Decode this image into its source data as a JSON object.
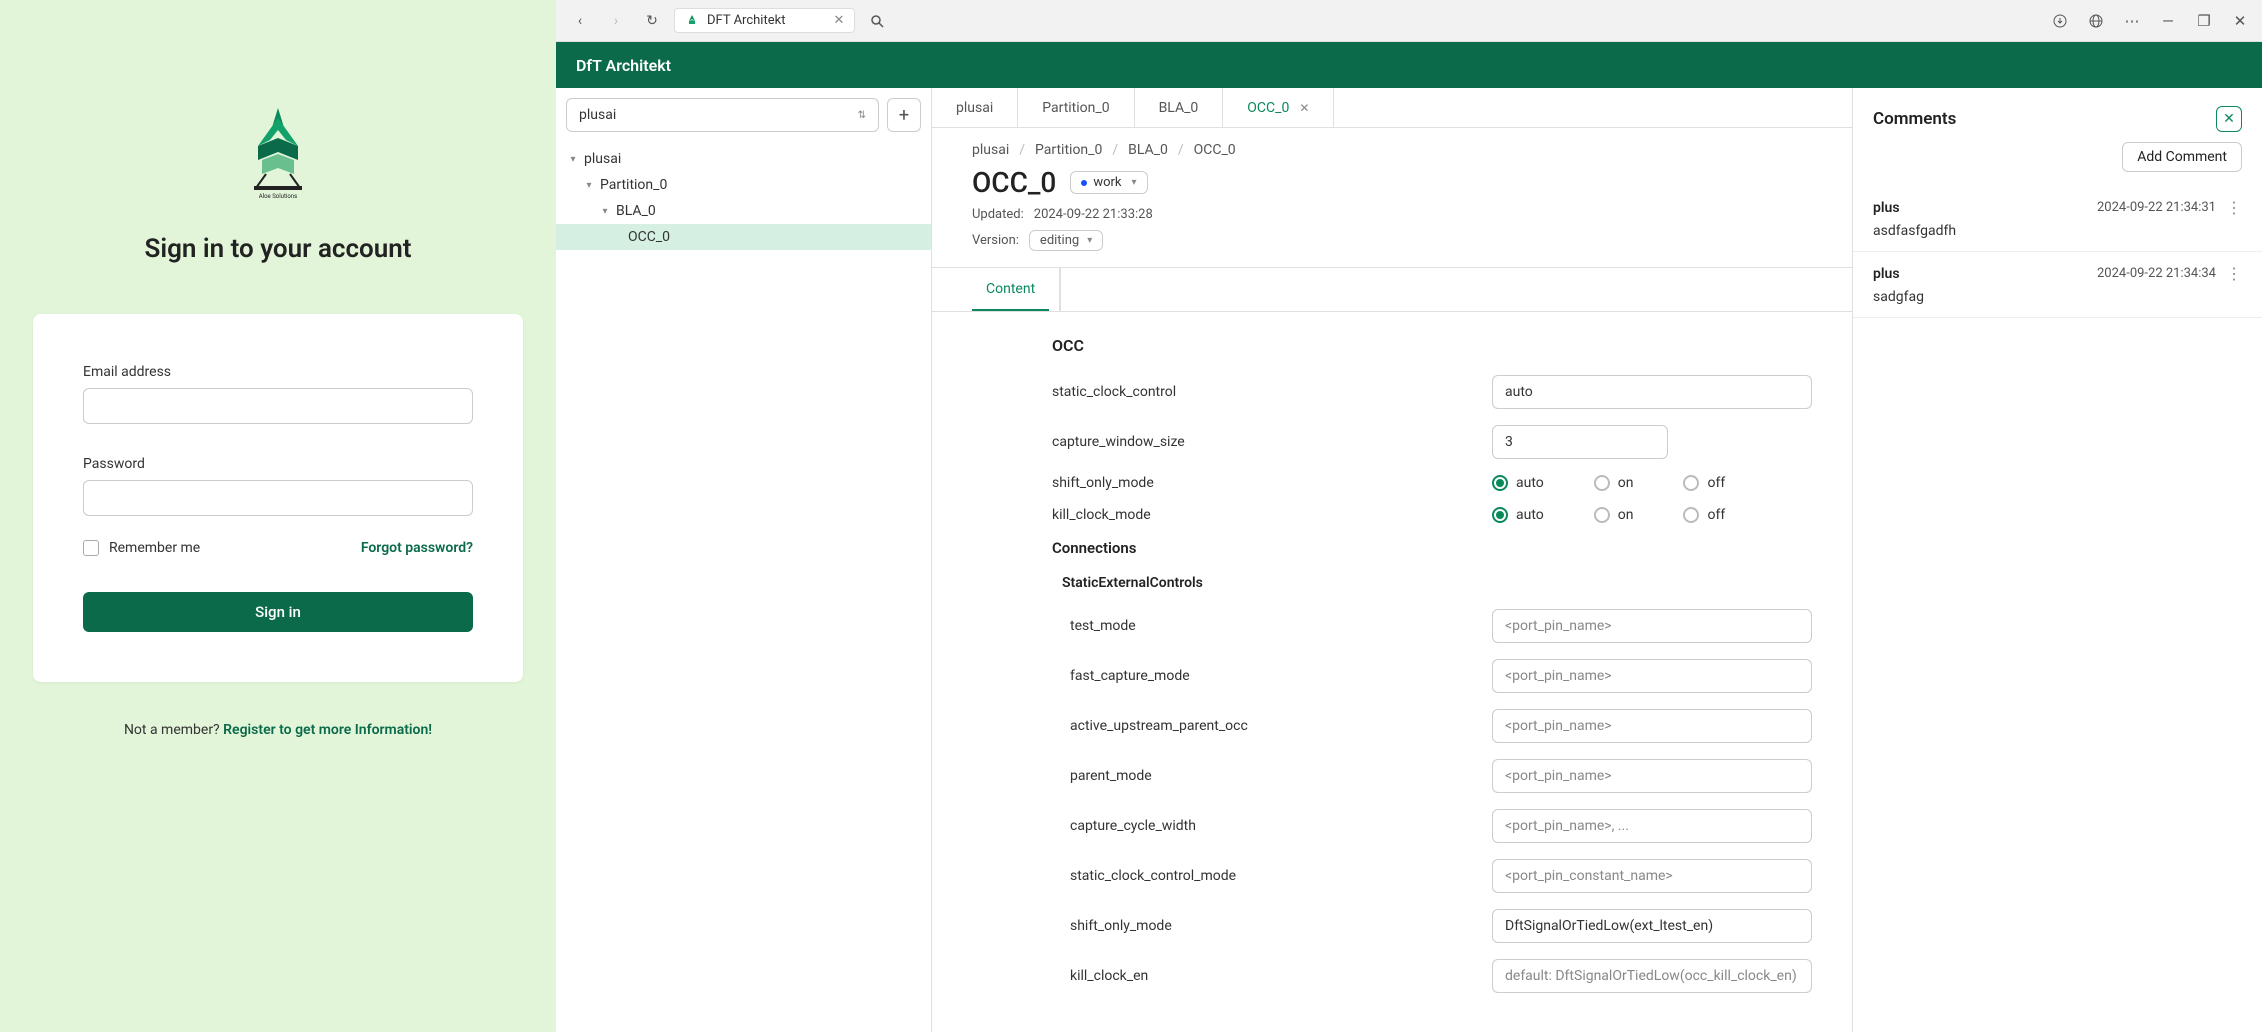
{
  "login": {
    "signin_title": "Sign in to your account",
    "email_label": "Email address",
    "password_label": "Password",
    "remember_label": "Remember me",
    "forgot_label": "Forgot password?",
    "signin_button": "Sign in",
    "register_prefix": "Not a member? ",
    "register_link": "Register to get more Information!",
    "logo_caption": "Aloe Solutions"
  },
  "chrome": {
    "tab_title": "DFT Architekt"
  },
  "header": {
    "title": "DfT Architekt"
  },
  "tree": {
    "selector_value": "plusai",
    "items": [
      "plusai",
      "Partition_0",
      "BLA_0",
      "OCC_0"
    ]
  },
  "tabs": [
    "plusai",
    "Partition_0",
    "BLA_0",
    "OCC_0"
  ],
  "breadcrumb": [
    "plusai",
    "Partition_0",
    "BLA_0",
    "OCC_0"
  ],
  "page": {
    "title": "OCC_0",
    "tag": "work",
    "updated_label": "Updated:",
    "updated_value": "2024-09-22 21:33:28",
    "version_label": "Version:",
    "version_value": "editing",
    "content_tab": "Content"
  },
  "form": {
    "occ_heading": "OCC",
    "fields": {
      "static_clock_control": {
        "label": "static_clock_control",
        "value": "auto"
      },
      "capture_window_size": {
        "label": "capture_window_size",
        "value": "3"
      },
      "shift_only_mode": {
        "label": "shift_only_mode",
        "value": "auto"
      },
      "kill_clock_mode": {
        "label": "kill_clock_mode",
        "value": "auto"
      }
    },
    "radio_options": {
      "auto": "auto",
      "on": "on",
      "off": "off"
    },
    "connections_heading": "Connections",
    "static_ext_heading": "StaticExternalControls",
    "conn": {
      "test_mode": {
        "label": "test_mode",
        "placeholder": "<port_pin_name>"
      },
      "fast_capture_mode": {
        "label": "fast_capture_mode",
        "placeholder": "<port_pin_name>"
      },
      "active_upstream_parent_occ": {
        "label": "active_upstream_parent_occ",
        "placeholder": "<port_pin_name>"
      },
      "parent_mode": {
        "label": "parent_mode",
        "placeholder": "<port_pin_name>"
      },
      "capture_cycle_width": {
        "label": "capture_cycle_width",
        "placeholder": "<port_pin_name>, ..."
      },
      "static_clock_control_mode": {
        "label": "static_clock_control_mode",
        "placeholder": "<port_pin_constant_name>"
      },
      "shift_only_mode": {
        "label": "shift_only_mode",
        "value": "DftSignalOrTiedLow(ext_ltest_en)"
      },
      "kill_clock_en": {
        "label": "kill_clock_en",
        "placeholder": "default: DftSignalOrTiedLow(occ_kill_clock_en)"
      }
    }
  },
  "comments": {
    "title": "Comments",
    "add_button": "Add Comment",
    "items": [
      {
        "author": "plus",
        "time": "2024-09-22 21:34:31",
        "body": "asdfasfgadfh"
      },
      {
        "author": "plus",
        "time": "2024-09-22 21:34:34",
        "body": "sadgfag"
      }
    ]
  }
}
